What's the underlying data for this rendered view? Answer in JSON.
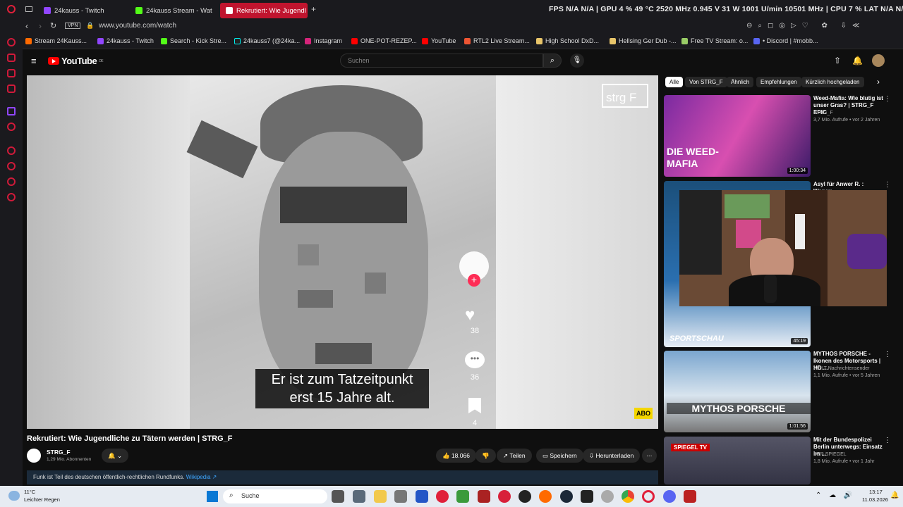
{
  "browser": {
    "tabs": [
      {
        "label": "24kauss - Twitch",
        "color": "#9146ff"
      },
      {
        "label": "24kauss Stream - Wat",
        "color": "#53fc18"
      },
      {
        "label": "Rekrutiert: Wie Jugendl",
        "color": "#ff0000"
      }
    ],
    "stats": "FPS  N/A  N/A   |   GPU  4 %  49 °C  2520 MHz  0.945 V  31 W  1001 U/min  10501 MHz   |   CPU  7 %       LAT  N/A  N/A",
    "vpn": "VPN",
    "url": "www.youtube.com/watch",
    "bookmarks": [
      "Stream 24Kauss...",
      "24kauss - Twitch",
      "Search - Kick Stre...",
      "24kauss7 (@24ka...",
      "Instagram",
      "ONE-POT-REZEP...",
      "YouTube",
      "RTL2 Live Stream...",
      "High School DxD...",
      "Hellsing Ger Dub -...",
      "Free TV Stream: o...",
      "• Discord | #mobb..."
    ]
  },
  "youtube": {
    "logo": "YouTube",
    "region": "DE",
    "search_placeholder": "Suchen",
    "video": {
      "subtitle_line1": "Er ist zum Tatzeitpunkt",
      "subtitle_line2": "erst 15 Jahre alt.",
      "watermark": "strg F",
      "abo_badge": "ABO",
      "likes": "38",
      "comments": "36",
      "saves": "4",
      "title": "Rekrutiert: Wie Jugendliche zu Tätern werden | STRG_F",
      "channel": "STRG_F",
      "subscribers": "1,29 Mio. Abonnenten",
      "like_count": "18.066",
      "share": "Teilen",
      "save": "Speichern",
      "download": "Herunterladen",
      "info": "Funk ist Teil des deutschen öffentlich-rechtlichen Rundfunks.",
      "info_link": "Wikipedia ↗"
    },
    "chips": [
      "Alle",
      "Von STRG_F",
      "Ähnlich",
      "Empfehlungen",
      "Kürzlich hochgeladen"
    ],
    "related": [
      {
        "title": "Weed-Mafia: Wie blutig ist unser Gras? | STRG_F EPIC",
        "channel": "STRG_F",
        "meta": "3,7 Mio. Aufrufe • vor 2 Jahren",
        "duration": "1:00:34",
        "thumb_text": "DIE WEED-MAFIA"
      },
      {
        "title": "Asyl für Anwer R. : Warum",
        "channel": "",
        "meta": "",
        "duration": "45:19",
        "thumb_text": "SPORTSCHAU"
      },
      {
        "title": "MYTHOS PORSCHE - Ikonen des Motorsports | HD ...",
        "channel": "WELT Nachrichtensender",
        "meta": "1,1 Mio. Aufrufe • vor 5 Jahren",
        "duration": "1:01:56",
        "thumb_text": "MYTHOS PORSCHE"
      },
      {
        "title": "Mit der Bundespolizei Berlin unterwegs: Einsatz im ...",
        "channel": "DER SPIEGEL",
        "meta": "1,8 Mio. Aufrufe • vor 1 Jahr",
        "duration": "",
        "thumb_text": "SPIEGEL TV"
      }
    ]
  },
  "taskbar": {
    "weather_temp": "11°C",
    "weather_desc": "Leichter Regen",
    "search": "Suche",
    "time": "13:17",
    "date": "11.03.2026"
  }
}
